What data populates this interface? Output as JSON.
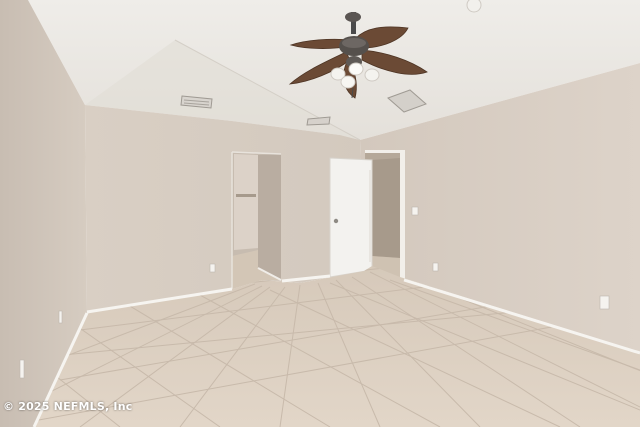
{
  "photo": {
    "subject": "empty bedroom with tile floor, ceiling fan and open doors",
    "watermark": "© 2025 NEFMLS, Inc",
    "colors": {
      "wall_light": "#d7cdc3",
      "wall_shadow": "#c2b7ac",
      "ceiling": "#e9e6e1",
      "floor": "#ddd0c1",
      "grout": "#c9bcae",
      "baseboard": "#f6f4f0",
      "door": "#f1f1ef",
      "fan_blade": "#6b4a35",
      "fan_metal": "#4a4a4a"
    },
    "objects": [
      "ceiling-fan",
      "light-kit",
      "vents",
      "doorways",
      "open-door",
      "baseboards",
      "outlets",
      "tile-floor"
    ]
  }
}
